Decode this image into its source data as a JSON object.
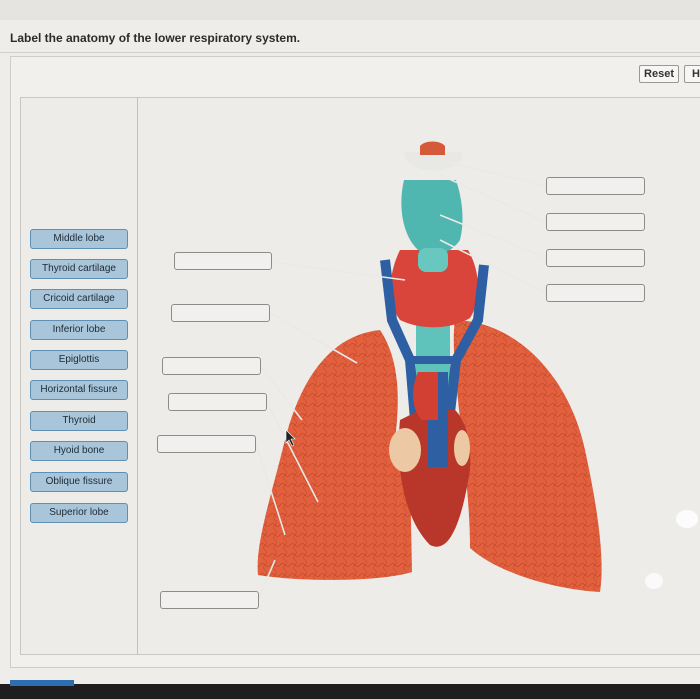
{
  "question": {
    "title": "Label the anatomy of the lower respiratory system."
  },
  "toolbar": {
    "reset_label": "Reset",
    "help_label": "H"
  },
  "label_bank": {
    "labels": [
      "Middle lobe",
      "Thyroid cartilage",
      "Cricoid cartilage",
      "Inferior lobe",
      "Epiglottis",
      "Horizontal fissure",
      "Thyroid",
      "Hyoid bone",
      "Oblique fissure",
      "Superior lobe"
    ]
  },
  "drop_targets": {
    "count": 10,
    "filled": 0
  },
  "image_colors": {
    "lung": "#e2603d",
    "cartilage": "#4fb7b0",
    "vessel": "#2e5fa3",
    "heart": "#b9372a",
    "chip": "#a8c5da"
  }
}
